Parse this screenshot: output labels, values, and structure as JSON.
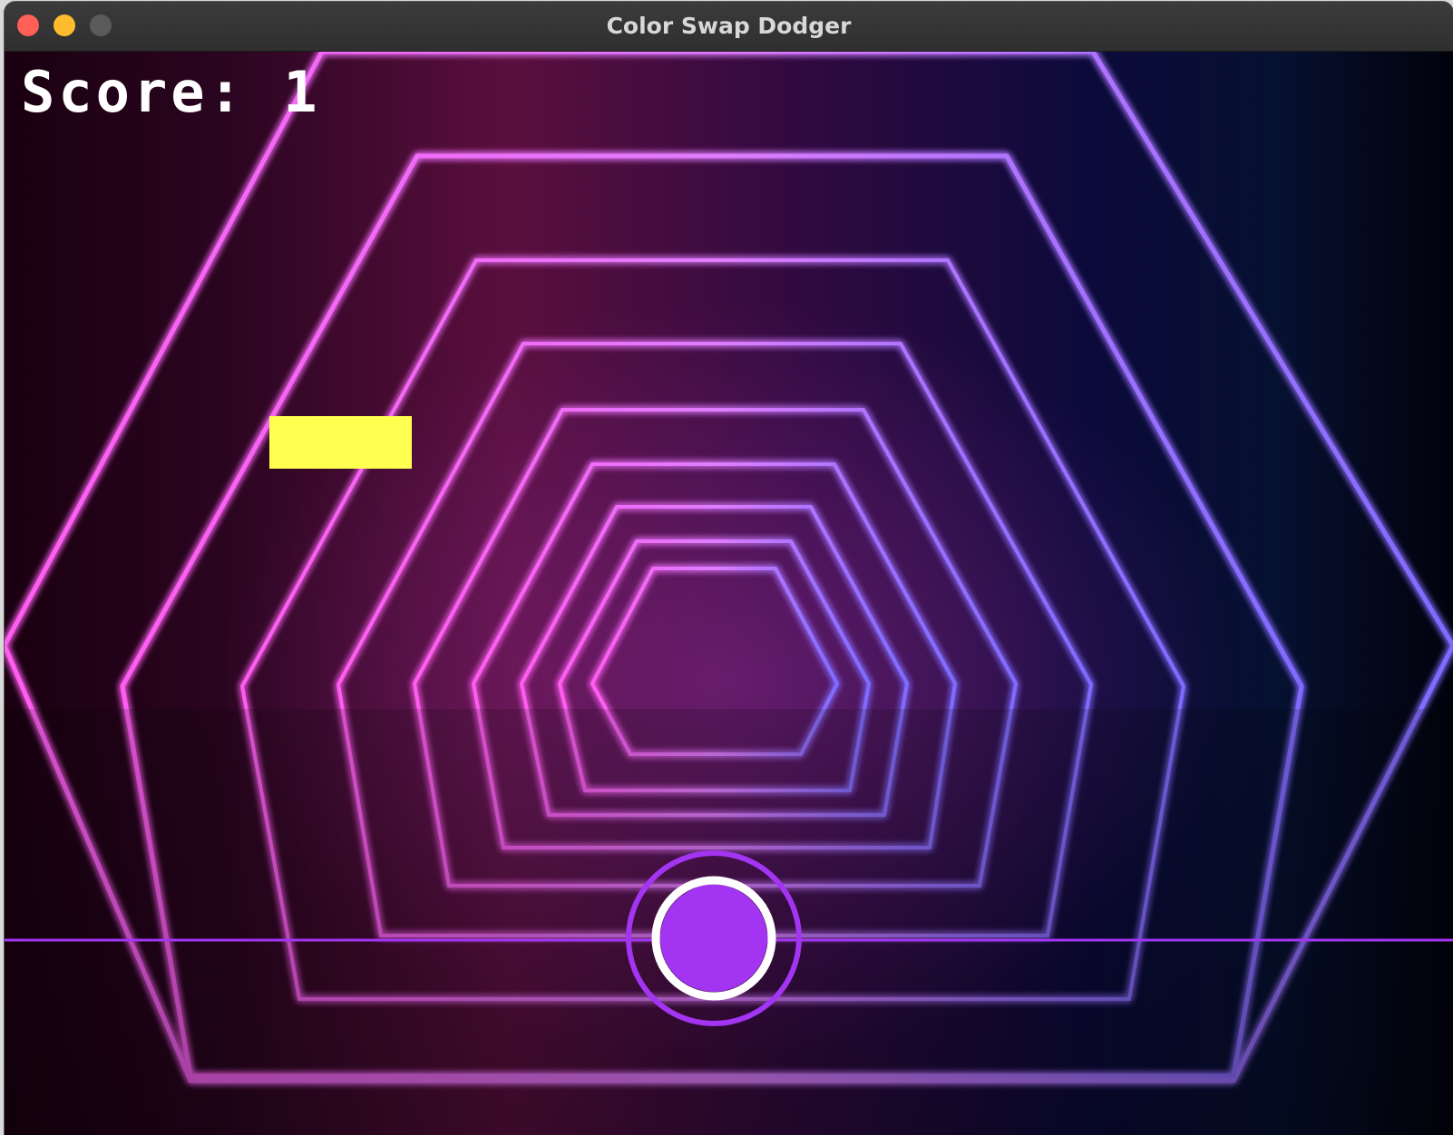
{
  "window": {
    "title": "Color Swap Dodger"
  },
  "hud": {
    "score_label": "Score:",
    "score_value": "1"
  },
  "colors": {
    "background_left": "#5a0f3e",
    "background_right": "#050a2a",
    "neon_pink": "#ff5cf0",
    "neon_blue": "#7f6bff",
    "obstacle": "#ffff50",
    "player": "#a234f2",
    "player_ring": "#ffffff",
    "player_outer_ring": "#a234f2",
    "ground_line": "#a234f2"
  },
  "icons": {
    "close": "close-icon",
    "minimize": "minimize-icon",
    "maximize": "maximize-icon"
  }
}
